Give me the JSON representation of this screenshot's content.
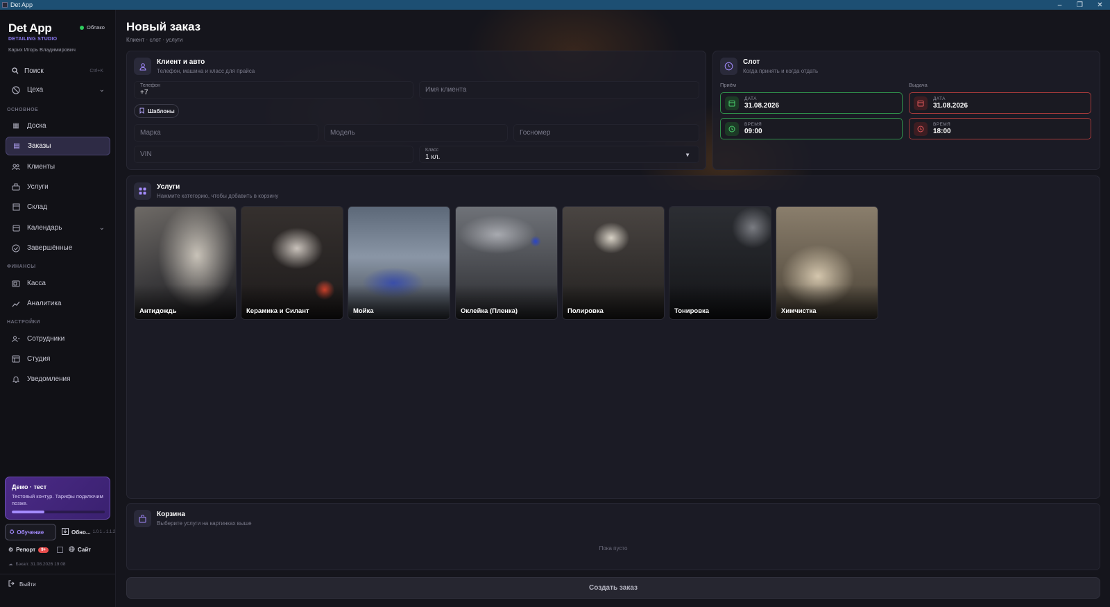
{
  "window": {
    "title": "Det App",
    "controls": [
      "–",
      "❐",
      "✕"
    ]
  },
  "sidebar": {
    "brand": "Det App",
    "brand_sub": "DETAILING STUDIO",
    "user": "Карих Игорь Владимирович",
    "cloud_status": "Облако",
    "search_label": "Поиск",
    "search_shortcut": "Ctrl+K",
    "workshop": "Цеха",
    "sections": {
      "main": "ОСНОВНОЕ",
      "finance": "ФИНАНСЫ",
      "settings": "НАСТРОЙКИ"
    },
    "items": [
      {
        "label": "Доска",
        "icon": "dashboard-icon"
      },
      {
        "label": "Заказы",
        "icon": "orders-icon",
        "active": true
      },
      {
        "label": "Клиенты",
        "icon": "users-icon"
      },
      {
        "label": "Услуги",
        "icon": "services-icon"
      },
      {
        "label": "Склад",
        "icon": "warehouse-icon"
      },
      {
        "label": "Календарь",
        "icon": "calendar-icon"
      },
      {
        "label": "Завершённые",
        "icon": "check-circle-icon"
      },
      {
        "label": "Касса",
        "icon": "cash-icon"
      },
      {
        "label": "Аналитика",
        "icon": "analytics-icon"
      },
      {
        "label": "Сотрудники",
        "icon": "staff-icon"
      },
      {
        "label": "Студия",
        "icon": "studio-icon"
      },
      {
        "label": "Уведомления",
        "icon": "bell-icon"
      }
    ],
    "demo": {
      "title": "Демо · тест",
      "desc": "Тестовый контур. Тарифы подключим позже.",
      "progress": 0.35
    },
    "learn_label": "Обучение",
    "update_label": "Обно...",
    "update_version": "1.0.1→1.1.2",
    "report_label": "Репорт",
    "report_badge": "9+",
    "site_label": "Сайт",
    "backup": "Бэкап: 31.08.2026 19:08",
    "logout": "Выйти"
  },
  "page": {
    "title": "Новый заказ",
    "subtitle": "Клиент · слот · услуги"
  },
  "client": {
    "title": "Клиент и авто",
    "subtitle": "Телефон, машина и класс для прайса",
    "phone_label": "Телефон",
    "phone_value": "+7",
    "name_placeholder": "Имя клиента",
    "templates": "Шаблоны",
    "brand_placeholder": "Марка",
    "model_placeholder": "Модель",
    "plate_placeholder": "Госномер",
    "vin_placeholder": "VIN",
    "class_label": "Класс",
    "class_value": "1 кл."
  },
  "slot": {
    "title": "Слот",
    "subtitle": "Когда принять и когда отдать",
    "intake_label": "Приём",
    "issue_label": "Выдача",
    "date_label": "ДАТА",
    "time_label": "ВРЕМЯ",
    "intake_date": "31.08.2026",
    "intake_time": "09:00",
    "issue_date": "31.08.2026",
    "issue_time": "18:00"
  },
  "services": {
    "title": "Услуги",
    "subtitle": "Нажмите категорию, чтобы добавить в корзину",
    "categories": [
      "Антидождь",
      "Керамика и Силант",
      "Мойка",
      "Оклейка (Пленка)",
      "Полировка",
      "Тонировка",
      "Химчистка"
    ]
  },
  "cart": {
    "title": "Корзина",
    "subtitle": "Выберите услуги на картинках выше",
    "empty": "Пока пусто"
  },
  "create_button": "Создать заказ",
  "colors": {
    "accent": "#8f7cf7",
    "success": "#2f8f4a",
    "danger": "#a63a3a",
    "background": "#15151c"
  }
}
